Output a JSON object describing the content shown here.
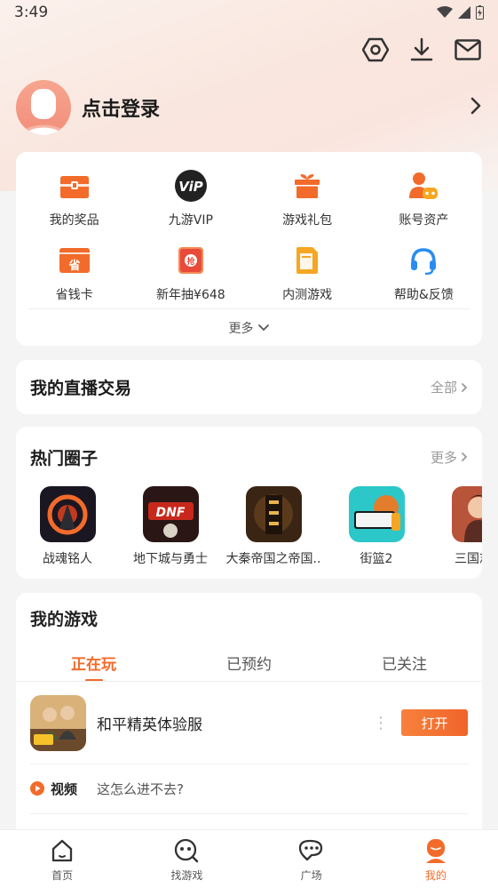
{
  "status_bar": {
    "time": "3:49"
  },
  "profile": {
    "login_text": "点击登录"
  },
  "quick_grid": {
    "items": [
      {
        "label": "我的奖品",
        "icon": "prize-box-icon"
      },
      {
        "label": "九游VIP",
        "icon": "vip-badge-icon"
      },
      {
        "label": "游戏礼包",
        "icon": "gift-icon"
      },
      {
        "label": "账号资产",
        "icon": "account-asset-icon"
      },
      {
        "label": "省钱卡",
        "icon": "saving-card-icon",
        "icon_text": "省"
      },
      {
        "label": "新年抽¥648",
        "icon": "lottery-icon",
        "icon_text": "抢"
      },
      {
        "label": "内测游戏",
        "icon": "beta-game-icon"
      },
      {
        "label": "帮助&反馈",
        "icon": "headset-icon"
      }
    ],
    "more_label": "更多"
  },
  "live_trade": {
    "title": "我的直播交易",
    "link": "全部"
  },
  "circles": {
    "title": "热门圈子",
    "link": "更多",
    "items": [
      {
        "name": "战魂铭人"
      },
      {
        "name": "地下城与勇士"
      },
      {
        "name": "大秦帝国之帝国.."
      },
      {
        "name": "街篮2"
      },
      {
        "name": "三国志幻"
      }
    ]
  },
  "my_games": {
    "title": "我的游戏",
    "tabs": [
      "正在玩",
      "已预约",
      "已关注"
    ],
    "active_tab": 0,
    "game": {
      "name": "和平精英体验服",
      "button": "打开"
    },
    "video": {
      "label": "视频",
      "text": "这怎么进不去?"
    }
  },
  "bottom_nav": {
    "items": [
      {
        "label": "首页",
        "icon": "home-icon"
      },
      {
        "label": "找游戏",
        "icon": "find-game-icon"
      },
      {
        "label": "广场",
        "icon": "square-chat-icon"
      },
      {
        "label": "我的",
        "icon": "me-icon"
      }
    ],
    "active": 3
  },
  "colors": {
    "accent": "#f26b2b",
    "card": "#ffffff",
    "background": "#f4f4f4"
  }
}
